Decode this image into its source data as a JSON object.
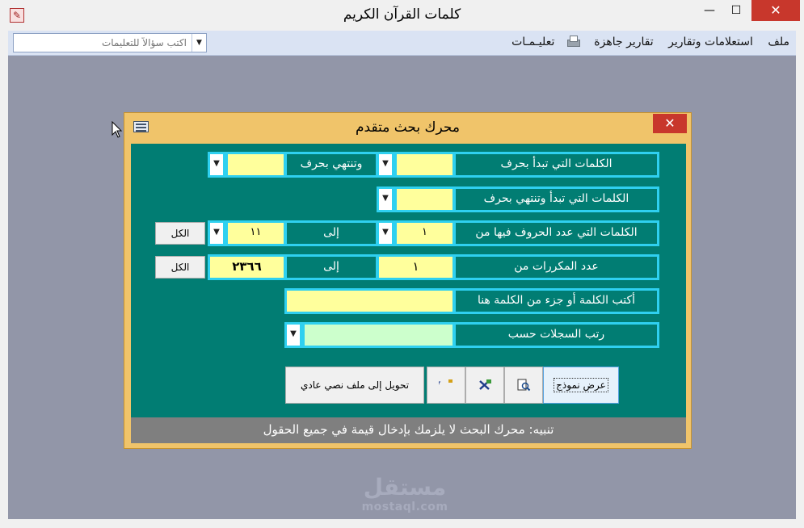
{
  "window": {
    "title": "كلمات القرآن الكريم",
    "min_glyph": "—",
    "max_glyph": "☐",
    "close_glyph": "✕"
  },
  "menubar": {
    "items": [
      "ملف",
      "استعلامات وتقارير",
      "تقارير جاهزة",
      "تعليـمـات"
    ],
    "ask_placeholder": "اكتب سؤالاً للتعليمات",
    "drop_glyph": "▼"
  },
  "dialog": {
    "title": "محرك بحث متقدم",
    "close_glyph": "✕",
    "rows": {
      "starts_with_label": "الكلمات التي تبدأ بحرف",
      "ends_with_label": "وتنتهي بحرف",
      "start_end_label": "الكلمات التي تبدأ وتنتهي بحرف",
      "letter_count_label": "الكلمات التي عدد الحروف فيها من",
      "letter_count_from": "١",
      "to_label": "إلى",
      "letter_count_to": "١١",
      "repeat_label": "عدد المكررات من",
      "repeat_from": "١",
      "repeat_to": "٢٣٦٦",
      "word_label": "أكتب الكلمة أو جزء من الكلمة هنا",
      "word_value": "",
      "sort_label": "رتب السجلات حسب",
      "sort_value": ""
    },
    "all_button": "الكل",
    "drop_glyph": "▼",
    "buttons": {
      "preview": "عرض نموذج",
      "export_text": "تحويل إلى ملف نصي عادي"
    },
    "notice": "تنبيه: محرك البحث لا يلزمك بإدخال قيمة في جميع الحقول"
  },
  "watermark": {
    "logo": "مستقل",
    "url": "mostaql.com"
  },
  "colors": {
    "dialog_bg": "#017d73",
    "dialog_frame": "#f0c46a",
    "field_yellow": "#ffff9c",
    "field_green": "#ccffcc",
    "field_border": "#2fd0f0",
    "workspace": "#9296a8",
    "close_red": "#c8372c"
  }
}
